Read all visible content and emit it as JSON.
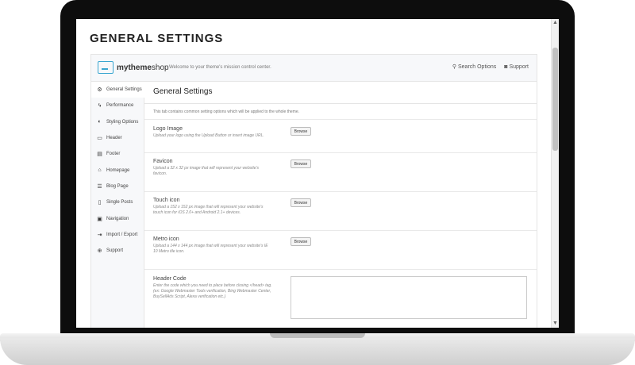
{
  "page": {
    "title": "GENERAL SETTINGS"
  },
  "header": {
    "logo_text_bold": "mytheme",
    "logo_text_rest": "shop",
    "welcome": "Welcome to your theme's mission control center.",
    "search_options": "Search Options",
    "support": "Support"
  },
  "sidebar": {
    "items": [
      {
        "label": "General Settings",
        "icon": "gear-icon"
      },
      {
        "label": "Performance",
        "icon": "bolt-icon"
      },
      {
        "label": "Styling Options",
        "icon": "contrast-icon"
      },
      {
        "label": "Header",
        "icon": "header-icon"
      },
      {
        "label": "Footer",
        "icon": "footer-icon"
      },
      {
        "label": "Homepage",
        "icon": "home-icon"
      },
      {
        "label": "Blog Page",
        "icon": "list-icon"
      },
      {
        "label": "Single Posts",
        "icon": "file-icon"
      },
      {
        "label": "Navigation",
        "icon": "navigation-icon"
      },
      {
        "label": "Import / Export",
        "icon": "import-icon"
      },
      {
        "label": "Support",
        "icon": "lifebuoy-icon"
      }
    ]
  },
  "content": {
    "title": "General Settings",
    "description": "This tab contains common setting options which will be applied to the whole theme.",
    "browse_label": "Browse",
    "options": [
      {
        "title": "Logo Image",
        "desc": "Upload your logo using the Upload Button or insert image URL."
      },
      {
        "title": "Favicon",
        "desc": "Upload a 32 x 32 px image that will represent your website's favicon."
      },
      {
        "title": "Touch icon",
        "desc": "Upload a 152 x 152 px image that will represent your website's touch icon for iOS 2.0+ and Android 2.1+ devices."
      },
      {
        "title": "Metro icon",
        "desc": "Upload a 144 x 144 px image that will represent your website's IE 10 Metro tile icon."
      },
      {
        "title": "Header Code",
        "desc": "Enter the code which you need to place before closing </head> tag. (ex: Google Webmaster Tools verification, Bing Webmaster Center, BuySellAds Script, Alexa verification etc.)"
      }
    ]
  }
}
